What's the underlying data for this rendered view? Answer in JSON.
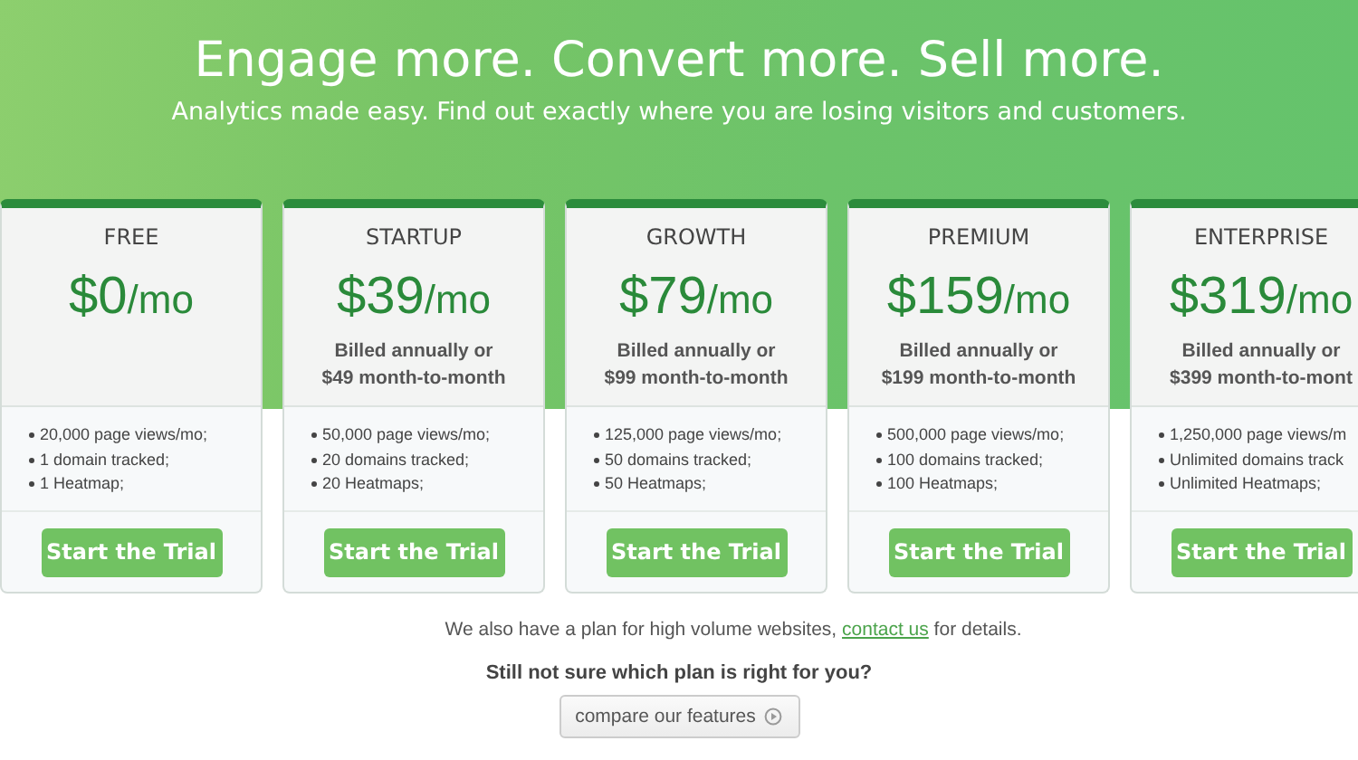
{
  "hero": {
    "title": "Engage more. Convert more. Sell more.",
    "subtitle": "Analytics made easy. Find out exactly where you are losing visitors and customers."
  },
  "plans": [
    {
      "name": "FREE",
      "price": "$0",
      "unit": "/mo",
      "features": [
        "20,000 page views/mo;",
        "1 domain tracked;",
        "1 Heatmap;"
      ],
      "button": "Start the Trial"
    },
    {
      "name": "STARTUP",
      "price": "$39",
      "unit": "/mo",
      "billing": [
        "Billed annually or",
        "$49 month-to-month"
      ],
      "features": [
        "50,000 page views/mo;",
        "20 domains tracked;",
        "20 Heatmaps;"
      ],
      "button": "Start the Trial"
    },
    {
      "name": "GROWTH",
      "price": "$79",
      "unit": "/mo",
      "billing": [
        "Billed annually or",
        "$99 month-to-month"
      ],
      "features": [
        "125,000 page views/mo;",
        "50 domains tracked;",
        "50 Heatmaps;"
      ],
      "button": "Start the Trial"
    },
    {
      "name": "PREMIUM",
      "price": "$159",
      "unit": "/mo",
      "billing": [
        "Billed annually or",
        "$199 month-to-month"
      ],
      "features": [
        "500,000 page views/mo;",
        "100 domains tracked;",
        "100 Heatmaps;"
      ],
      "button": "Start the Trial"
    },
    {
      "name": "ENTERPRISE",
      "price": "$319",
      "unit": "/mo",
      "billing": [
        "Billed annually or",
        "$399 month-to-mont"
      ],
      "features": [
        "1,250,000 page views/m",
        "Unlimited domains track",
        "Unlimited Heatmaps;"
      ],
      "button": "Start the Trial"
    }
  ],
  "note": {
    "before": "We also have a plan for high volume websites,",
    "link": "contact us",
    "after": "for details."
  },
  "question": "Still not sure which plan is right for you?",
  "compare_button": "compare our features"
}
